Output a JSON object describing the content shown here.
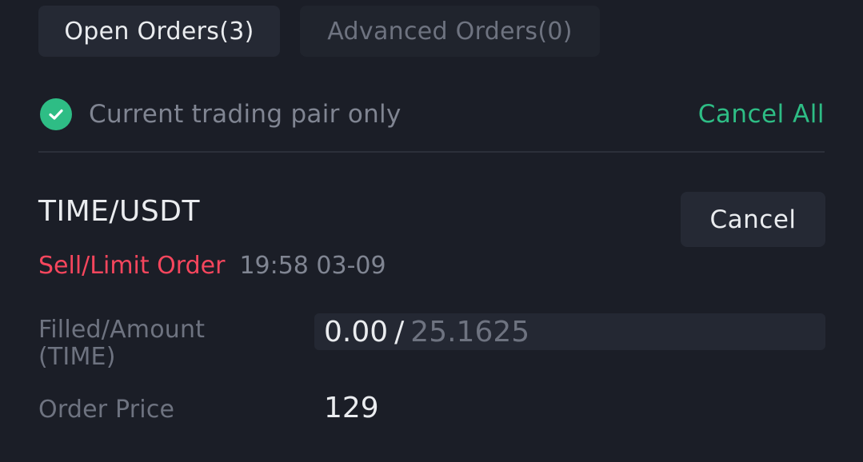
{
  "tabs": {
    "open_orders": "Open Orders(3)",
    "advanced_orders": "Advanced Orders(0)"
  },
  "filter": {
    "label": "Current trading pair only",
    "checked": true,
    "icon": "check-circle-icon"
  },
  "cancel_all": "Cancel All",
  "order": {
    "pair": "TIME/USDT",
    "cancel_label": "Cancel",
    "type": "Sell/Limit Order",
    "time": "19:58 03-09",
    "filled_label_line1": "Filled/Amount",
    "filled_label_line2": "(TIME)",
    "filled": "0.00",
    "separator": "/",
    "amount": "25.1625",
    "price_label": "Order Price",
    "price": "129"
  },
  "colors": {
    "background": "#1b1e27",
    "accent_green": "#2ebd85",
    "sell_red": "#f6465d",
    "muted_text": "#808592"
  }
}
